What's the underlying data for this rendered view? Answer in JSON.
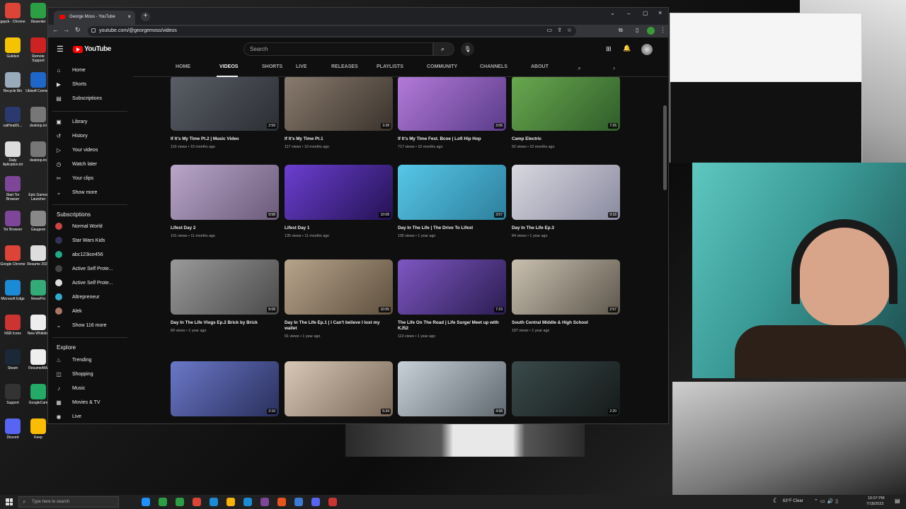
{
  "desktop": {
    "icons": [
      {
        "label": "gayck - Chrome",
        "color": "#db4437"
      },
      {
        "label": "Guilded",
        "color": "#f5c400"
      },
      {
        "label": "Recycle Bin",
        "color": "#9ab"
      },
      {
        "label": "catHeat01...",
        "color": "#2a3a6e"
      },
      {
        "label": "Daily Aplication.txt",
        "color": "#ddd"
      },
      {
        "label": "Start Tor Browser",
        "color": "#7d4698"
      },
      {
        "label": "Tor Browser",
        "color": "#7d4698"
      },
      {
        "label": "Google Chrome",
        "color": "#db4437"
      },
      {
        "label": "Microsoft Edge",
        "color": "#1b8bd6"
      },
      {
        "label": "NSB Icons",
        "color": "#c33"
      },
      {
        "label": "Steam",
        "color": "#1b2838"
      },
      {
        "label": "Support",
        "color": "#333"
      },
      {
        "label": "Discord",
        "color": "#5865f2"
      }
    ],
    "icons2": [
      {
        "label": "Dissenter",
        "color": "#2c9f45"
      },
      {
        "label": "Remote Support",
        "color": "#c22"
      },
      {
        "label": "Ubisoft Connect",
        "color": "#1e66c8"
      },
      {
        "label": "desktop.ini",
        "color": "#777"
      },
      {
        "label": "desktop.ini",
        "color": "#777"
      },
      {
        "label": "Epic Games Launcher",
        "color": "#222"
      },
      {
        "label": "Gaugeon",
        "color": "#888"
      },
      {
        "label": "Resume 2023",
        "color": "#ddd"
      },
      {
        "label": "NewsPro",
        "color": "#3a7"
      },
      {
        "label": "New Whitelist",
        "color": "#eee"
      },
      {
        "label": "ResumeAiW",
        "color": "#eee"
      },
      {
        "label": "GoogleCam",
        "color": "#2a6"
      },
      {
        "label": "Keep",
        "color": "#fbbc04"
      }
    ]
  },
  "browser": {
    "tab_title": "George Moss - YouTube",
    "url": "youtube.com/@georgemoss/videos"
  },
  "youtube": {
    "logo": "YouTube",
    "search_placeholder": "Search",
    "channel_tabs": [
      "HOME",
      "VIDEOS",
      "SHORTS",
      "LIVE",
      "RELEASES",
      "PLAYLISTS",
      "COMMUNITY",
      "CHANNELS",
      "ABOUT"
    ],
    "sidebar_main": [
      {
        "label": "Home",
        "icon": "home-icon",
        "glyph": "⌂"
      },
      {
        "label": "Shorts",
        "icon": "shorts-icon",
        "glyph": "▶"
      },
      {
        "label": "Subscriptions",
        "icon": "subscriptions-icon",
        "glyph": "▤"
      }
    ],
    "sidebar_library": [
      {
        "label": "Library",
        "icon": "library-icon",
        "glyph": "▣"
      },
      {
        "label": "History",
        "icon": "history-icon",
        "glyph": "↺"
      },
      {
        "label": "Your videos",
        "icon": "your-videos-icon",
        "glyph": "▷"
      },
      {
        "label": "Watch later",
        "icon": "watch-later-icon",
        "glyph": "◷"
      },
      {
        "label": "Your clips",
        "icon": "clips-icon",
        "glyph": "✂"
      },
      {
        "label": "Show more",
        "icon": "chevron-down-icon",
        "glyph": "⌄"
      }
    ],
    "subscriptions_heading": "Subscriptions",
    "subscriptions": [
      {
        "label": "Normal World",
        "color": "#c44"
      },
      {
        "label": "Star Wars Kids",
        "color": "#335"
      },
      {
        "label": "abc123ice456",
        "color": "#2a8"
      },
      {
        "label": "Active Self Prote...",
        "color": "#444"
      },
      {
        "label": "Active Self Prote...",
        "color": "#ddd"
      },
      {
        "label": "Altrepreneur",
        "color": "#3ac"
      },
      {
        "label": "Alek",
        "color": "#a76"
      }
    ],
    "show_more_subs": "Show 116 more",
    "explore_heading": "Explore",
    "explore": [
      {
        "label": "Trending",
        "icon": "trending-icon",
        "glyph": "♨"
      },
      {
        "label": "Shopping",
        "icon": "shopping-icon",
        "glyph": "◫"
      },
      {
        "label": "Music",
        "icon": "music-icon",
        "glyph": "♪"
      },
      {
        "label": "Movies & TV",
        "icon": "movies-icon",
        "glyph": "▦"
      },
      {
        "label": "Live",
        "icon": "live-icon",
        "glyph": "◉"
      }
    ],
    "videos": [
      {
        "title": "If It's My Time Pt.2 | Music Video",
        "meta": "110 views • 10 months ago",
        "duration": "2:59",
        "c1": "#5a5f66",
        "c2": "#2b2e33"
      },
      {
        "title": "If It's My Time Pt.1",
        "meta": "117 views • 10 months ago",
        "duration": "3:28",
        "c1": "#8a7b6e",
        "c2": "#3a332c"
      },
      {
        "title": "If It's My Time Fest. Bcoe | Lofi Hip Hop",
        "meta": "717 views • 10 months ago",
        "duration": "3:06",
        "c1": "#b47ad8",
        "c2": "#5a3c8a"
      },
      {
        "title": "Camp Electric",
        "meta": "92 views • 10 months ago",
        "duration": "7:26",
        "c1": "#6aa84f",
        "c2": "#2f5d2a"
      },
      {
        "title": "Lifest Day 2",
        "meta": "101 views • 11 months ago",
        "duration": "9:58",
        "c1": "#b9a6c9",
        "c2": "#6b5a7a"
      },
      {
        "title": "Lifest Day 1",
        "meta": "135 views • 11 months ago",
        "duration": "10:08",
        "c1": "#6b3fd1",
        "c2": "#241253"
      },
      {
        "title": "Day In The Life | The Drive To Lifest",
        "meta": "105 views • 1 year ago",
        "duration": "3:57",
        "c1": "#57c7e8",
        "c2": "#2d7f9c"
      },
      {
        "title": "Day In The Life Ep.3",
        "meta": "84 views • 1 year ago",
        "duration": "9:18",
        "c1": "#d8d8e0",
        "c2": "#8a8aa0"
      },
      {
        "title": "Day In The Life Vlogs Ep.2 Brick by Brick",
        "meta": "89 views • 1 year ago",
        "duration": "8:08",
        "c1": "#9a9a9a",
        "c2": "#4a4a4a"
      },
      {
        "title": "Day In The Life Ep.1 | I Can't believe I lost my wallet",
        "meta": "91 views • 1 year ago",
        "duration": "10:55",
        "c1": "#b7a48c",
        "c2": "#5e503e"
      },
      {
        "title": "The Life On The Road | Life Surge/ Meet up with KJ52",
        "meta": "113 views • 1 year ago",
        "duration": "7:23",
        "c1": "#7e57c2",
        "c2": "#2b1d52"
      },
      {
        "title": "South Central Middle & High School",
        "meta": "187 views • 1 year ago",
        "duration": "2:57",
        "c1": "#c9c0b0",
        "c2": "#5e574c"
      },
      {
        "title": "",
        "meta": "",
        "duration": "2:16",
        "c1": "#6a78c8",
        "c2": "#2a2f5c"
      },
      {
        "title": "",
        "meta": "",
        "duration": "5:34",
        "c1": "#d8c8b8",
        "c2": "#7a6858"
      },
      {
        "title": "",
        "meta": "",
        "duration": "4:58",
        "c1": "#c8d0d8",
        "c2": "#606870"
      },
      {
        "title": "",
        "meta": "",
        "duration": "2:20",
        "c1": "#3a4a4a",
        "c2": "#151a1a"
      }
    ]
  },
  "taskbar": {
    "search_placeholder": "Type here to search",
    "weather": "63°F  Clear",
    "time": "10:07 PM",
    "date": "7/18/2023"
  }
}
